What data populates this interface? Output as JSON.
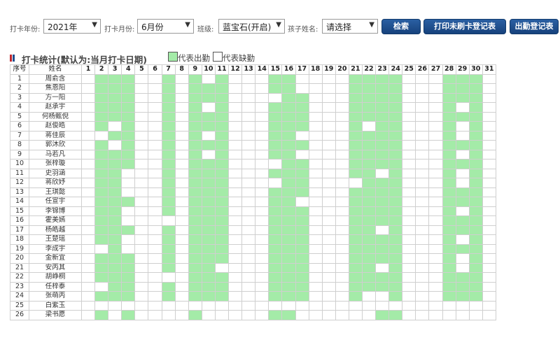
{
  "filters": {
    "year_label": "打卡年份:",
    "year_value": "2021年",
    "month_label": "打卡月份:",
    "month_value": "6月份",
    "class_label": "班级:",
    "class_value": "蓝宝石(开启)",
    "child_label": "孩子姓名:",
    "child_value": "请选择",
    "search_label": "检索",
    "print_label": "打印未刷卡登记表",
    "attendance_label": "出勤登记表"
  },
  "section": {
    "title": "打卡统计(默认为:当月打卡日期)",
    "legend_present": "代表出勤",
    "legend_absent": "代表缺勤"
  },
  "colors": {
    "present": "#a4eba8",
    "absent": "#ffffff",
    "button": "#1f4f8f",
    "marker_red": "#c0272d",
    "marker_blue": "#1f4f8f"
  },
  "table": {
    "index_header": "序号",
    "name_header": "姓名",
    "days": [
      "1",
      "2",
      "3",
      "4",
      "5",
      "6",
      "7",
      "8",
      "9",
      "10",
      "11",
      "12",
      "13",
      "14",
      "15",
      "16",
      "17",
      "18",
      "19",
      "20",
      "21",
      "22",
      "23",
      "24",
      "25",
      "26",
      "27",
      "28",
      "29",
      "30",
      "31"
    ],
    "rows": [
      {
        "no": "1",
        "name": "周俞含",
        "att": "0111001010100011000011110001110"
      },
      {
        "no": "2",
        "name": "焦恩阳",
        "att": "0111001011100011000011110001110"
      },
      {
        "no": "3",
        "name": "方一阳",
        "att": "0111001011100001100011110001110"
      },
      {
        "no": "4",
        "name": "赵承宇",
        "att": "0111001010100011100011110001010"
      },
      {
        "no": "5",
        "name": "何杨甄倪",
        "att": "0111001011100011100011110001110"
      },
      {
        "no": "6",
        "name": "赵俊皓",
        "att": "0101001011100011100010110001010"
      },
      {
        "no": "7",
        "name": "蒋佳辰",
        "att": "0011001010100011000011110001010"
      },
      {
        "no": "8",
        "name": "郭沐欣",
        "att": "0101001011100011100011110001110"
      },
      {
        "no": "9",
        "name": "马若凡",
        "att": "0111001010100011000011110001010"
      },
      {
        "no": "10",
        "name": "张梓璇",
        "att": "0111001011100001100011110001110"
      },
      {
        "no": "11",
        "name": "史羽涵",
        "att": "0110001011100011100011010001010"
      },
      {
        "no": "12",
        "name": "蒋欣妤",
        "att": "0110001011100001100001110001010"
      },
      {
        "no": "13",
        "name": "王琪懿",
        "att": "0110001011100011100011110001110"
      },
      {
        "no": "14",
        "name": "任宣宇",
        "att": "0111001011100011000011110001110"
      },
      {
        "no": "15",
        "name": "李锦博",
        "att": "0110001011100011100011110001010"
      },
      {
        "no": "16",
        "name": "霍美嫣",
        "att": "0110000011100011100011110001110"
      },
      {
        "no": "17",
        "name": "杨皓越",
        "att": "0111001011100011100011010001110"
      },
      {
        "no": "18",
        "name": "王楚瑶",
        "att": "0110001011100011100011110001010"
      },
      {
        "no": "19",
        "name": "李成宇",
        "att": "0010001011100011100011110001110"
      },
      {
        "no": "20",
        "name": "金新宜",
        "att": "0111001011100011100011110001010"
      },
      {
        "no": "21",
        "name": "安丙其",
        "att": "0111001011000011100011010001010"
      },
      {
        "no": "22",
        "name": "胡峥桐",
        "att": "0111000011100011100011110001110"
      },
      {
        "no": "23",
        "name": "任梓泰",
        "att": "0011001011100011100011110001110"
      },
      {
        "no": "24",
        "name": "张萌丙",
        "att": "0111001011100011100010010001110"
      },
      {
        "no": "25",
        "name": "白紫玉",
        "att": "0000000000000000000000000000000"
      },
      {
        "no": "26",
        "name": "梁书愿",
        "att": "0101000010000011000000110000000"
      }
    ]
  }
}
